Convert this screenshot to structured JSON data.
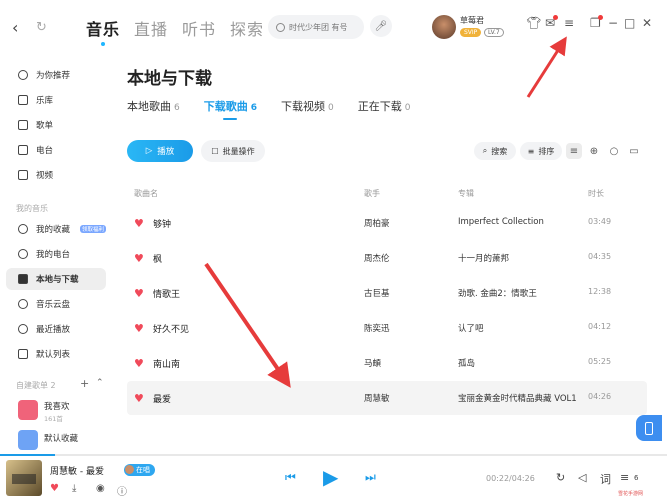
{
  "topbar": {
    "tabs": [
      "音乐",
      "直播",
      "听书",
      "探索"
    ],
    "search_placeholder": "时代少年团 有号",
    "user_name": "草莓君",
    "badge_svip": "SVIP",
    "badge_level": "LV.7"
  },
  "sidebar": {
    "items": [
      {
        "label": "为你推荐",
        "icon": "recommend-icon"
      },
      {
        "label": "乐库",
        "icon": "library-icon"
      },
      {
        "label": "歌单",
        "icon": "playlist-icon"
      },
      {
        "label": "电台",
        "icon": "radio-icon"
      },
      {
        "label": "视频",
        "icon": "video-icon"
      }
    ],
    "my_music_header": "我的音乐",
    "my_items": [
      {
        "label": "我的收藏",
        "icon": "heart-icon",
        "tag": "领取福利"
      },
      {
        "label": "我的电台",
        "icon": "radio-icon"
      },
      {
        "label": "本地与下载",
        "icon": "download-icon"
      },
      {
        "label": "音乐云盘",
        "icon": "cloud-icon"
      },
      {
        "label": "最近播放",
        "icon": "clock-icon"
      },
      {
        "label": "默认列表",
        "icon": "list-icon"
      }
    ],
    "custom_header": "自建歌单 2",
    "playlists": [
      {
        "title": "我喜欢",
        "sub": "161首",
        "color": "#f0637a"
      },
      {
        "title": "默认收藏",
        "sub": "",
        "color": "#6ea3f5"
      }
    ]
  },
  "main": {
    "title": "本地与下载",
    "tabs": [
      {
        "label": "本地歌曲",
        "count": "6"
      },
      {
        "label": "下载歌曲",
        "count": "6"
      },
      {
        "label": "下载视频",
        "count": "0"
      },
      {
        "label": "正在下载",
        "count": "0"
      }
    ],
    "play_label": "播放",
    "batch_label": "批量操作",
    "search_label": "搜索",
    "sort_label": "排序",
    "columns": {
      "song": "歌曲名",
      "artist": "歌手",
      "album": "专辑",
      "duration": "时长"
    },
    "rows": [
      {
        "song": "够钟",
        "artist": "周柏豪",
        "album": "Imperfect Collection",
        "duration": "03:49"
      },
      {
        "song": "枫",
        "artist": "周杰伦",
        "album": "十一月的萧邦",
        "duration": "04:35"
      },
      {
        "song": "情歌王",
        "artist": "古巨基",
        "album": "劲歌. 金曲2：情歌王",
        "duration": "12:38"
      },
      {
        "song": "好久不见",
        "artist": "陈奕迅",
        "album": "认了吧",
        "duration": "04:12"
      },
      {
        "song": "南山南",
        "artist": "马頔",
        "album": "孤岛",
        "duration": "05:25"
      },
      {
        "song": "最爱",
        "artist": "周慧敏",
        "album": "宝丽金黄金时代精品典藏 VOL1",
        "duration": "04:26"
      }
    ]
  },
  "player": {
    "song": "周慧敏 - 最爱",
    "tag": "在唱",
    "time": "00:22/04:26",
    "count": "6",
    "lyrics_label": "词",
    "progress": 0.083
  },
  "watermark": "雪花手游网"
}
